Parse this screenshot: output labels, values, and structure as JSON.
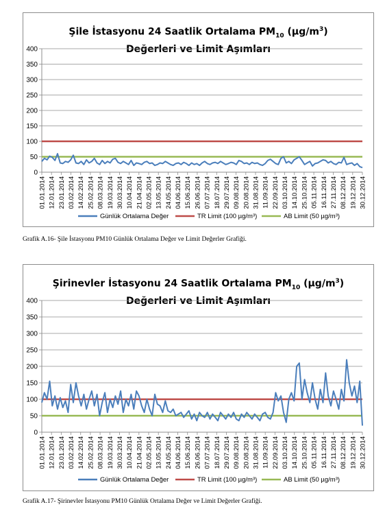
{
  "charts": [
    {
      "title_line1_prefix": "Şile İstasyonu 24 Saatlik Ortalama PM",
      "title_sub": "10",
      "title_unit_prefix": " (µg/m",
      "title_unit_sup": "3",
      "title_unit_suffix": ")",
      "title_line2": "Değerleri ve Limit Aşımları",
      "caption": "Grafik A.16- Şile İstasyonu PM10 Günlük Ortalama Değer ve Limit Değerler Grafiği."
    },
    {
      "title_line1_prefix": "Şirinevler İstasyonu 24 Saatlik Ortalama PM",
      "title_sub": "10",
      "title_unit_prefix": " (µg/m",
      "title_unit_sup": "3",
      "title_unit_suffix": ")",
      "title_line2": "Değerleri ve Limit Aşımları",
      "caption": "Grafik A.17-  Şirinevler İstasyonu PM10 Günlük Ortalama Değer ve Limit Değerler Grafiği."
    }
  ],
  "chart_data": [
    {
      "type": "line",
      "title": "Şile İstasyonu 24 Saatlik Ortalama PM10 (µg/m3) Değerleri ve Limit Aşımları",
      "ylim": [
        0,
        400
      ],
      "yticks": [
        0,
        50,
        100,
        150,
        200,
        250,
        300,
        350,
        400
      ],
      "x_tick_labels": [
        "01.01.2014",
        "12.01.2014",
        "23.01.2014",
        "03.02.2014",
        "14.02.2014",
        "25.02.2014",
        "08.03.2014",
        "19.03.2014",
        "30.03.2014",
        "10.04.2014",
        "21.04.2014",
        "02.05.2014",
        "13.05.2014",
        "24.05.2014",
        "04.06.2014",
        "15.06.2014",
        "26.06.2014",
        "07.07.2014",
        "18.07.2014",
        "29.07.2014",
        "09.08.2014",
        "20.08.2014",
        "31.08.2014",
        "11.09.2014",
        "22.09.2014",
        "03.10.2014",
        "14.10.2014",
        "25.10.2014",
        "05.11.2014",
        "16.11.2014",
        "27.11.2014",
        "08.12.2014",
        "19.12.2014",
        "30.12.2014"
      ],
      "grid": true,
      "legend_position": "bottom",
      "colors": {
        "daily": "#4a7ebb",
        "tr_limit": "#be4b48",
        "ab_limit": "#98b954"
      },
      "series": [
        {
          "name": "Günlük Ortalama Değer",
          "x_start": "01.01.2014",
          "x_step_days": 3,
          "values": [
            35,
            45,
            40,
            52,
            48,
            38,
            60,
            30,
            28,
            35,
            32,
            40,
            55,
            30,
            28,
            35,
            25,
            40,
            30,
            35,
            45,
            30,
            25,
            38,
            28,
            35,
            30,
            42,
            45,
            32,
            28,
            35,
            30,
            25,
            38,
            22,
            30,
            28,
            25,
            32,
            35,
            28,
            30,
            22,
            25,
            30,
            28,
            35,
            30,
            25,
            22,
            28,
            30,
            25,
            32,
            28,
            22,
            30,
            25,
            28,
            22,
            30,
            35,
            28,
            25,
            30,
            32,
            28,
            35,
            30,
            25,
            28,
            32,
            30,
            25,
            38,
            35,
            28,
            30,
            25,
            32,
            28,
            30,
            25,
            22,
            28,
            38,
            42,
            35,
            28,
            25,
            45,
            50,
            30,
            35,
            28,
            40,
            45,
            50,
            38,
            25,
            30,
            35,
            20,
            28,
            30,
            35,
            40,
            38,
            30,
            35,
            28,
            25,
            32,
            30,
            48,
            25,
            28,
            30,
            22,
            28,
            18,
            15
          ]
        },
        {
          "name": "TR Limit (100 µg/m³)",
          "value": 100
        },
        {
          "name": "AB Limit (50 µg/m³)",
          "value": 50
        }
      ]
    },
    {
      "type": "line",
      "title": "Şirinevler İstasyonu 24 Saatlik Ortalama PM10 (µg/m3) Değerleri ve Limit Aşımları",
      "ylim": [
        0,
        400
      ],
      "yticks": [
        0,
        50,
        100,
        150,
        200,
        250,
        300,
        350,
        400
      ],
      "x_tick_labels": [
        "01.01.2014",
        "12.01.2014",
        "23.01.2014",
        "03.02.2014",
        "14.02.2014",
        "25.02.2014",
        "08.03.2014",
        "19.03.2014",
        "30.03.2014",
        "10.04.2014",
        "21.04.2014",
        "02.05.2014",
        "13.05.2014",
        "24.05.2014",
        "04.06.2014",
        "15.06.2014",
        "26.06.2014",
        "07.07.2014",
        "18.07.2014",
        "29.07.2014",
        "09.08.2014",
        "20.08.2014",
        "31.08.2014",
        "11.09.2014",
        "22.09.2014",
        "03.10.2014",
        "14.10.2014",
        "25.10.2014",
        "05.11.2014",
        "16.11.2014",
        "27.11.2014",
        "08.12.2014",
        "19.12.2014",
        "30.12.2014"
      ],
      "grid": true,
      "legend_position": "bottom",
      "colors": {
        "daily": "#4a7ebb",
        "tr_limit": "#be4b48",
        "ab_limit": "#98b954"
      },
      "series": [
        {
          "name": "Günlük Ortalama Değer",
          "x_start": "01.01.2014",
          "x_step_days": 3,
          "values": [
            90,
            120,
            100,
            155,
            80,
            110,
            70,
            105,
            75,
            95,
            60,
            145,
            90,
            150,
            110,
            80,
            115,
            70,
            100,
            125,
            80,
            115,
            50,
            90,
            120,
            60,
            100,
            75,
            110,
            85,
            125,
            60,
            100,
            80,
            115,
            70,
            125,
            110,
            80,
            60,
            100,
            70,
            50,
            115,
            85,
            80,
            60,
            95,
            65,
            60,
            70,
            50,
            55,
            60,
            45,
            55,
            65,
            40,
            55,
            35,
            60,
            50,
            45,
            60,
            40,
            55,
            45,
            35,
            60,
            50,
            40,
            55,
            45,
            60,
            40,
            35,
            55,
            45,
            60,
            50,
            40,
            55,
            45,
            35,
            55,
            60,
            45,
            40,
            60,
            120,
            95,
            110,
            60,
            30,
            100,
            120,
            95,
            200,
            210,
            100,
            160,
            120,
            90,
            150,
            100,
            70,
            130,
            90,
            180,
            110,
            80,
            125,
            100,
            70,
            130,
            95,
            220,
            150,
            110,
            140,
            90,
            155,
            20
          ]
        },
        {
          "name": "TR Limit (100 µg/m³)",
          "value": 100
        },
        {
          "name": "AB Limit (50 µg/m³)",
          "value": 50
        }
      ]
    }
  ]
}
